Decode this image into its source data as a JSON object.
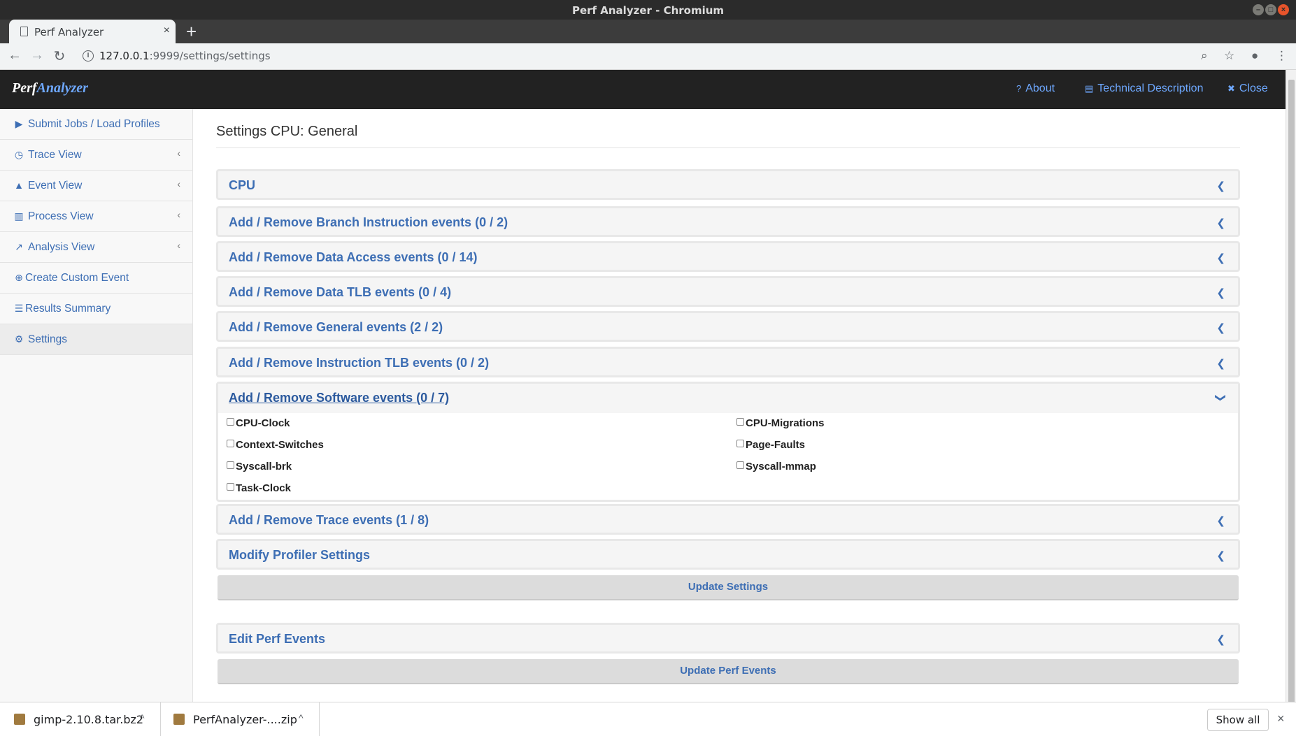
{
  "window": {
    "title": "Perf Analyzer - Chromium",
    "controls": {
      "minimize": "–",
      "maximize": "□",
      "close": "×"
    }
  },
  "browser": {
    "tab_title": "Perf Analyzer",
    "tab_close": "×",
    "new_tab": "+",
    "url_host": "127.0.0.1",
    "url_path": ":9999/settings/settings",
    "back": "←",
    "forward": "→",
    "reload": "↻",
    "zoom_icon": "⌕",
    "star_icon": "☆",
    "account_icon": "●",
    "menu_icon": "⋮",
    "info_icon": "i"
  },
  "app": {
    "brand_part1": "Perf",
    "brand_part2": "Analyzer",
    "nav": {
      "about_icon": "?",
      "about": "About",
      "tech_icon": "▤",
      "tech": "Technical Description",
      "close_icon": "✖",
      "close": "Close"
    }
  },
  "sidebar": {
    "items": [
      {
        "icon": "▶",
        "label": "Submit Jobs / Load Profiles",
        "chevron": ""
      },
      {
        "icon": "◷",
        "label": "Trace View",
        "chevron": "‹"
      },
      {
        "icon": "▲",
        "label": "Event View",
        "chevron": "‹"
      },
      {
        "icon": "▥",
        "label": "Process View",
        "chevron": "‹"
      },
      {
        "icon": "↗",
        "label": "Analysis View",
        "chevron": "‹"
      },
      {
        "icon": "⊕",
        "label": "Create Custom Event",
        "chevron": ""
      },
      {
        "icon": "☰",
        "label": "Results Summary",
        "chevron": ""
      },
      {
        "icon": "⚙",
        "label": "Settings",
        "chevron": ""
      }
    ]
  },
  "main": {
    "page_title": "Settings CPU: General",
    "panels": [
      {
        "title": "CPU",
        "chevron": "❮"
      },
      {
        "title": "Add / Remove Branch Instruction events (0 / 2)",
        "chevron": "❮"
      },
      {
        "title": "Add / Remove Data Access events (0 / 14)",
        "chevron": "❮"
      },
      {
        "title": "Add / Remove Data TLB events (0 / 4)",
        "chevron": "❮"
      },
      {
        "title": "Add / Remove General events (2 / 2)",
        "chevron": "❮"
      },
      {
        "title": "Add / Remove Instruction TLB events (0 / 2)",
        "chevron": "❮"
      },
      {
        "title": "Add / Remove Software events (0 / 7)",
        "chevron": "❯"
      },
      {
        "title": "Add / Remove Trace events (1 / 8)",
        "chevron": "❮"
      },
      {
        "title": "Modify Profiler Settings",
        "chevron": "❮"
      }
    ],
    "software_events": [
      "CPU-Clock",
      "CPU-Migrations",
      "Context-Switches",
      "Page-Faults",
      "Syscall-brk",
      "Syscall-mmap",
      "Task-Clock"
    ],
    "update_settings": "Update Settings",
    "edit_perf_events": {
      "title": "Edit Perf Events",
      "chevron": "❮"
    },
    "update_perf_events": "Update Perf Events"
  },
  "downloads": {
    "items": [
      {
        "name": "gimp-2.10.8.tar.bz2",
        "caret": "^"
      },
      {
        "name": "PerfAnalyzer-....zip",
        "caret": "^"
      }
    ],
    "show_all": "Show all",
    "close": "×"
  }
}
